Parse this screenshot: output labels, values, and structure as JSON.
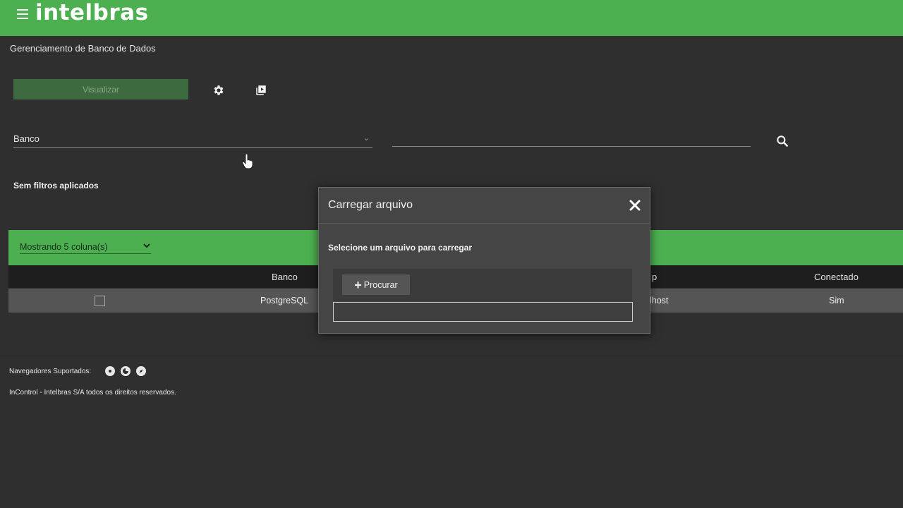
{
  "header": {
    "logo": "intelbras"
  },
  "page": {
    "title": "Gerenciamento de Banco de Dados"
  },
  "toolbar": {
    "view_label": "Visualizar"
  },
  "filters": {
    "select_value": "Banco",
    "search_placeholder": "",
    "status": "Sem filtros aplicados"
  },
  "table": {
    "columns_selector": "Mostrando 5 coluna(s)",
    "headers": [
      "Banco",
      "p",
      "Conectado"
    ],
    "row": {
      "banco": "PostgreSQL",
      "host": "lhost",
      "conectado": "Sim"
    }
  },
  "footer": {
    "browsers_label": "Navegadores Suportados:",
    "copyright": "InControl - Intelbras S/A todos os direitos reservados."
  },
  "modal": {
    "title": "Carregar arquivo",
    "label": "Selecione um arquivo para carregar",
    "browse_label": "Procurar",
    "file_value": ""
  },
  "colors": {
    "primary_green": "#4caf50",
    "background": "#2f2f2f"
  }
}
